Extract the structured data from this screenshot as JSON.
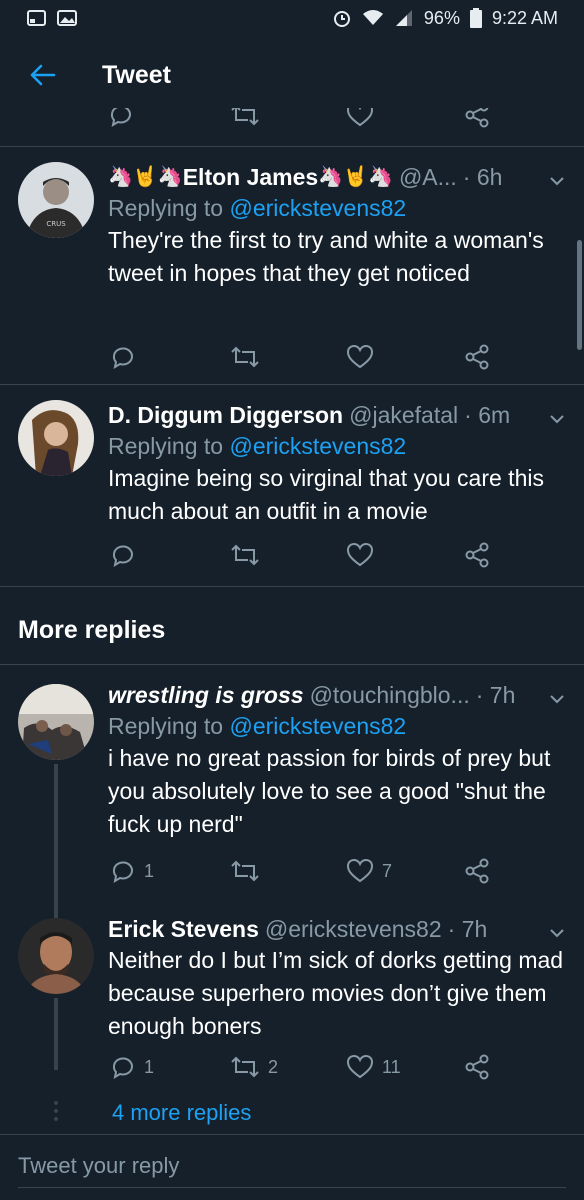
{
  "status": {
    "battery": "96%",
    "time": "9:22 AM"
  },
  "header": {
    "title": "Tweet"
  },
  "tweets": [
    {
      "name": "Elton James",
      "handle": "@A...",
      "time": "· 6h",
      "replying_prefix": "Replying to ",
      "replying_to": "@erickstevens82",
      "text": "They're the first to try and white a woman's tweet in hopes that they get noticed",
      "emoji_left": "🦄🤘🦄",
      "emoji_right": "🦄🤘🦄"
    },
    {
      "name": "D. Diggum Diggerson",
      "handle": "@jakefatal",
      "time": "· 6m",
      "replying_prefix": "Replying to ",
      "replying_to": "@erickstevens82",
      "text": "Imagine being so virginal that you care this much about an outfit in a movie"
    }
  ],
  "more_replies": {
    "heading": "More replies"
  },
  "replies": [
    {
      "name": "wrestling is gross",
      "handle": "@touchingblo...",
      "time": "· 7h",
      "replying_prefix": "Replying to ",
      "replying_to": "@erickstevens82",
      "text": "i have no great passion for birds of prey but you absolutely love to see a good \"shut the fuck up nerd\"",
      "reply_count": "1",
      "retweet_count": "",
      "like_count": "7"
    },
    {
      "name": "Erick Stevens",
      "handle": "@erickstevens82",
      "time": "· 7h",
      "text": "Neither do I but I’m sick of dorks getting mad because superhero movies don’t give them enough boners",
      "reply_count": "1",
      "retweet_count": "2",
      "like_count": "11"
    }
  ],
  "thread": {
    "more_link": "4 more replies"
  },
  "composer": {
    "placeholder": "Tweet your reply"
  },
  "colors": {
    "background": "#15202b",
    "accent": "#1da1f2",
    "muted": "#8899a6",
    "divider": "#38444d"
  },
  "icons": [
    "back-arrow-icon",
    "reply-icon",
    "retweet-icon",
    "like-icon",
    "share-icon",
    "chevron-down-icon",
    "wifi-icon",
    "battery-icon",
    "alarm-icon"
  ]
}
